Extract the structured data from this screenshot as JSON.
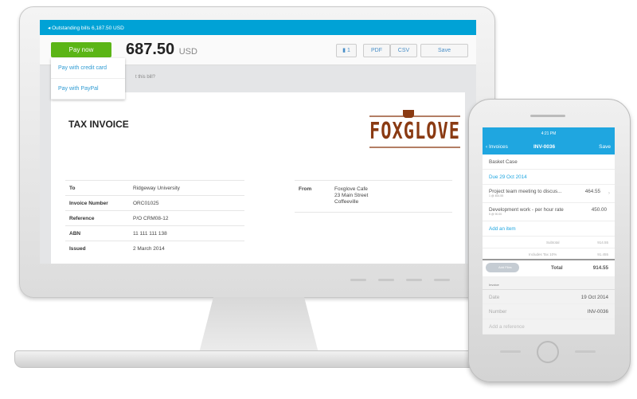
{
  "desktop": {
    "back_link": "Outstanding bills 6,187.50 USD",
    "pay_now": "Pay now",
    "amount": "687.50",
    "currency": "USD",
    "attachments": "1",
    "pdf": "PDF",
    "csv": "CSV",
    "save": "Save",
    "pay_options": [
      "Pay with credit card",
      "Pay with PayPal"
    ],
    "hint": "t this bill?",
    "invoice_title": "TAX INVOICE",
    "logo": "FOXGLOVE",
    "details": [
      {
        "k": "To",
        "v": "Ridgeway University"
      },
      {
        "k": "Invoice Number",
        "v": "ORC01025"
      },
      {
        "k": "Reference",
        "v": "P/O CRM08-12"
      },
      {
        "k": "ABN",
        "v": "11 111 111 138"
      },
      {
        "k": "Issued",
        "v": "2 March 2014"
      }
    ],
    "from_label": "From",
    "from_lines": [
      "Foxglove Cafe",
      "23 Main Street",
      "Coffeeville"
    ]
  },
  "phone": {
    "time": "4:21 PM",
    "back": "Invoices",
    "title": "INV-0036",
    "save": "Save",
    "contact": "Basket Case",
    "due": "Due 29 Oct 2014",
    "items": [
      {
        "desc": "Project team meeting to discus...",
        "sub": "1 @ 464.55",
        "amount": "464.55"
      },
      {
        "desc": "Development work - per hour rate",
        "sub": "5 @ 90.00",
        "amount": "450.00"
      }
    ],
    "add_item": "Add an item",
    "subtotal_label": "Subtotal",
    "subtotal": "914.55",
    "tax_label": "Includes Tax 10%",
    "tax": "91.455",
    "add_files": "Add Files",
    "total_label": "Total",
    "total": "914.55",
    "section": "Invoice",
    "date_label": "Date",
    "date": "19 Oct 2014",
    "number_label": "Number",
    "number": "INV-0036",
    "reference_placeholder": "Add a reference"
  },
  "colors": {
    "accent": "#00a2d6",
    "pay": "#5bb516",
    "brand": "#8a3a12"
  }
}
